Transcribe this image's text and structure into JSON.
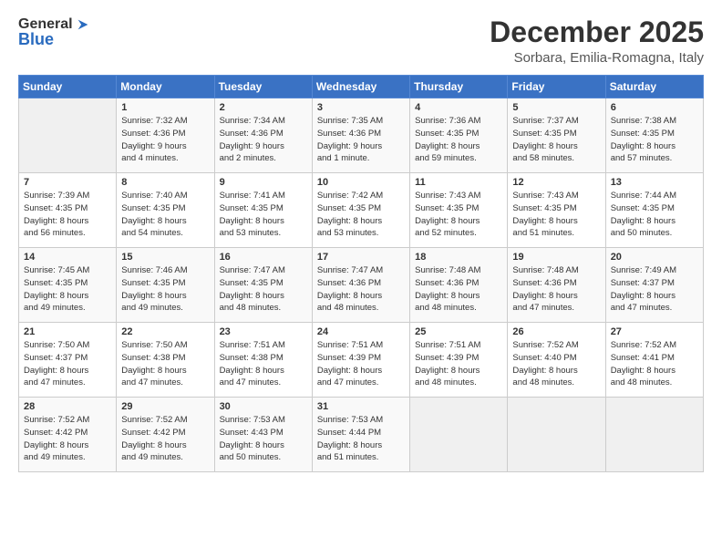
{
  "logo": {
    "general": "General",
    "blue": "Blue"
  },
  "title": {
    "month": "December 2025",
    "location": "Sorbara, Emilia-Romagna, Italy"
  },
  "weekdays": [
    "Sunday",
    "Monday",
    "Tuesday",
    "Wednesday",
    "Thursday",
    "Friday",
    "Saturday"
  ],
  "weeks": [
    [
      {
        "day": "",
        "info": ""
      },
      {
        "day": "1",
        "info": "Sunrise: 7:32 AM\nSunset: 4:36 PM\nDaylight: 9 hours\nand 4 minutes."
      },
      {
        "day": "2",
        "info": "Sunrise: 7:34 AM\nSunset: 4:36 PM\nDaylight: 9 hours\nand 2 minutes."
      },
      {
        "day": "3",
        "info": "Sunrise: 7:35 AM\nSunset: 4:36 PM\nDaylight: 9 hours\nand 1 minute."
      },
      {
        "day": "4",
        "info": "Sunrise: 7:36 AM\nSunset: 4:35 PM\nDaylight: 8 hours\nand 59 minutes."
      },
      {
        "day": "5",
        "info": "Sunrise: 7:37 AM\nSunset: 4:35 PM\nDaylight: 8 hours\nand 58 minutes."
      },
      {
        "day": "6",
        "info": "Sunrise: 7:38 AM\nSunset: 4:35 PM\nDaylight: 8 hours\nand 57 minutes."
      }
    ],
    [
      {
        "day": "7",
        "info": "Sunrise: 7:39 AM\nSunset: 4:35 PM\nDaylight: 8 hours\nand 56 minutes."
      },
      {
        "day": "8",
        "info": "Sunrise: 7:40 AM\nSunset: 4:35 PM\nDaylight: 8 hours\nand 54 minutes."
      },
      {
        "day": "9",
        "info": "Sunrise: 7:41 AM\nSunset: 4:35 PM\nDaylight: 8 hours\nand 53 minutes."
      },
      {
        "day": "10",
        "info": "Sunrise: 7:42 AM\nSunset: 4:35 PM\nDaylight: 8 hours\nand 53 minutes."
      },
      {
        "day": "11",
        "info": "Sunrise: 7:43 AM\nSunset: 4:35 PM\nDaylight: 8 hours\nand 52 minutes."
      },
      {
        "day": "12",
        "info": "Sunrise: 7:43 AM\nSunset: 4:35 PM\nDaylight: 8 hours\nand 51 minutes."
      },
      {
        "day": "13",
        "info": "Sunrise: 7:44 AM\nSunset: 4:35 PM\nDaylight: 8 hours\nand 50 minutes."
      }
    ],
    [
      {
        "day": "14",
        "info": "Sunrise: 7:45 AM\nSunset: 4:35 PM\nDaylight: 8 hours\nand 49 minutes."
      },
      {
        "day": "15",
        "info": "Sunrise: 7:46 AM\nSunset: 4:35 PM\nDaylight: 8 hours\nand 49 minutes."
      },
      {
        "day": "16",
        "info": "Sunrise: 7:47 AM\nSunset: 4:35 PM\nDaylight: 8 hours\nand 48 minutes."
      },
      {
        "day": "17",
        "info": "Sunrise: 7:47 AM\nSunset: 4:36 PM\nDaylight: 8 hours\nand 48 minutes."
      },
      {
        "day": "18",
        "info": "Sunrise: 7:48 AM\nSunset: 4:36 PM\nDaylight: 8 hours\nand 48 minutes."
      },
      {
        "day": "19",
        "info": "Sunrise: 7:48 AM\nSunset: 4:36 PM\nDaylight: 8 hours\nand 47 minutes."
      },
      {
        "day": "20",
        "info": "Sunrise: 7:49 AM\nSunset: 4:37 PM\nDaylight: 8 hours\nand 47 minutes."
      }
    ],
    [
      {
        "day": "21",
        "info": "Sunrise: 7:50 AM\nSunset: 4:37 PM\nDaylight: 8 hours\nand 47 minutes."
      },
      {
        "day": "22",
        "info": "Sunrise: 7:50 AM\nSunset: 4:38 PM\nDaylight: 8 hours\nand 47 minutes."
      },
      {
        "day": "23",
        "info": "Sunrise: 7:51 AM\nSunset: 4:38 PM\nDaylight: 8 hours\nand 47 minutes."
      },
      {
        "day": "24",
        "info": "Sunrise: 7:51 AM\nSunset: 4:39 PM\nDaylight: 8 hours\nand 47 minutes."
      },
      {
        "day": "25",
        "info": "Sunrise: 7:51 AM\nSunset: 4:39 PM\nDaylight: 8 hours\nand 48 minutes."
      },
      {
        "day": "26",
        "info": "Sunrise: 7:52 AM\nSunset: 4:40 PM\nDaylight: 8 hours\nand 48 minutes."
      },
      {
        "day": "27",
        "info": "Sunrise: 7:52 AM\nSunset: 4:41 PM\nDaylight: 8 hours\nand 48 minutes."
      }
    ],
    [
      {
        "day": "28",
        "info": "Sunrise: 7:52 AM\nSunset: 4:42 PM\nDaylight: 8 hours\nand 49 minutes."
      },
      {
        "day": "29",
        "info": "Sunrise: 7:52 AM\nSunset: 4:42 PM\nDaylight: 8 hours\nand 49 minutes."
      },
      {
        "day": "30",
        "info": "Sunrise: 7:53 AM\nSunset: 4:43 PM\nDaylight: 8 hours\nand 50 minutes."
      },
      {
        "day": "31",
        "info": "Sunrise: 7:53 AM\nSunset: 4:44 PM\nDaylight: 8 hours\nand 51 minutes."
      },
      {
        "day": "",
        "info": ""
      },
      {
        "day": "",
        "info": ""
      },
      {
        "day": "",
        "info": ""
      }
    ]
  ]
}
